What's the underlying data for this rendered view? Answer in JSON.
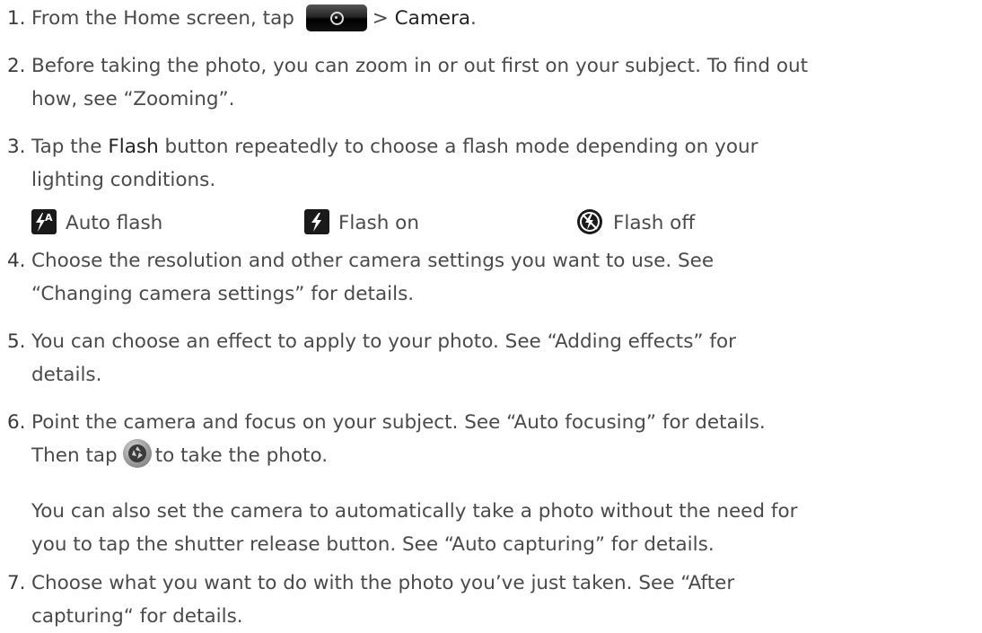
{
  "steps": [
    {
      "num": "1.",
      "pre": "From the Home screen, tap",
      "post_pre": "> ",
      "bold": "Camera",
      "post": "."
    },
    {
      "num": "2.",
      "line1": "Before taking the photo, you can zoom in or out first on your subject. To find out",
      "line2": "how, see “Zooming”."
    },
    {
      "num": "3.",
      "pre": "Tap the ",
      "bold": "Flash",
      "post": " button repeatedly to choose a flash mode depending on your",
      "line2": "lighting conditions."
    },
    {
      "num": "4.",
      "line1": "Choose the resolution and other camera settings you want to use. See",
      "line2": "“Changing camera settings” for details."
    },
    {
      "num": "5.",
      "line1": "You can choose an effect to apply to your photo. See “Adding effects” for",
      "line2": "details."
    },
    {
      "num": "6.",
      "line1": "Point the camera and focus on your subject. See “Auto focusing” for details.",
      "line2_pre": "Then tap",
      "line2_post": "to take the photo."
    },
    {
      "num": "7.",
      "line1": "Choose what you want to do with the photo you’ve just taken. See “After",
      "line2": "capturing“ for details."
    }
  ],
  "flash_modes": [
    {
      "icon": "auto-flash-icon",
      "label": "Auto flash"
    },
    {
      "icon": "flash-on-icon",
      "label": "Flash on"
    },
    {
      "icon": "flash-off-icon",
      "label": "Flash off"
    }
  ],
  "step6_note": {
    "line1": "You can also set the camera to automatically take a photo without the need for",
    "line2": "you to tap the shutter release button. See “Auto capturing” for details."
  },
  "colors": {
    "text": "#4a4a4a",
    "button_dark": "#1a1a1a"
  }
}
